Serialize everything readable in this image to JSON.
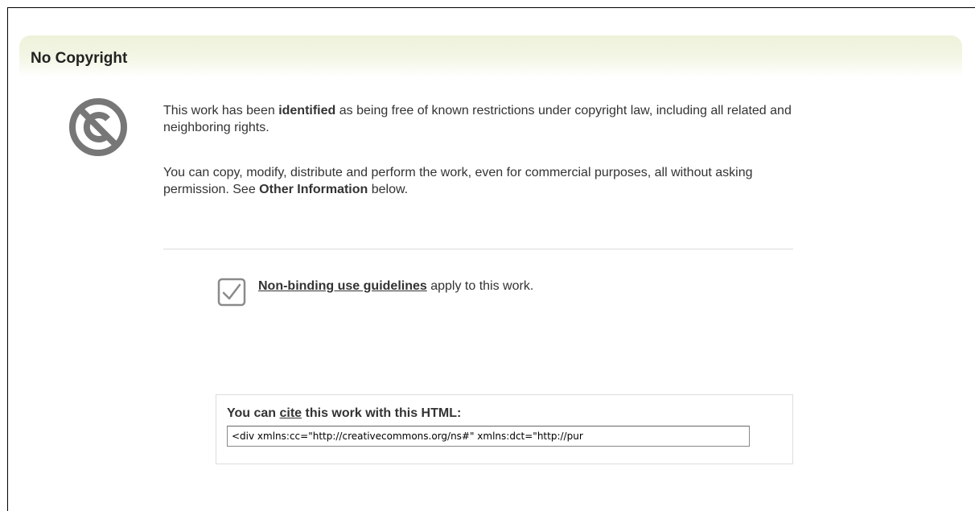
{
  "header": {
    "title": "No Copyright"
  },
  "summary": {
    "p1_before": "This work has been ",
    "p1_bold": "identified",
    "p1_after": " as being free of known restrictions under copyright law, including all related and neighboring rights.",
    "p2_before": "You can copy, modify, distribute and perform the work, even for commercial purposes, all without asking permission. See ",
    "p2_bold": "Other Information",
    "p2_after": " below."
  },
  "guidelines": {
    "link_text": "Non-binding use guidelines",
    "suffix": " apply to this work."
  },
  "cite": {
    "prefix": "You can ",
    "link_text": "cite",
    "suffix": " this work with this HTML:",
    "code_value": "<div xmlns:cc=\"http://creativecommons.org/ns#\" xmlns:dct=\"http://pur"
  },
  "colors": {
    "header_tint": "#eef2da",
    "icon_gray": "#777777",
    "text": "#333333"
  },
  "icons": {
    "license": "no-copyright-icon",
    "guidelines": "checkbox-check-icon"
  }
}
